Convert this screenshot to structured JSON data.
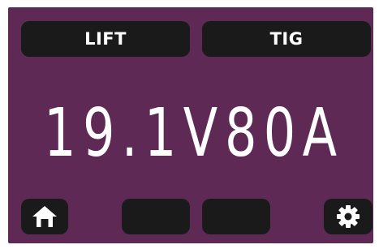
{
  "top_buttons": {
    "lift_label": "LIFT",
    "tig_label": "TIG"
  },
  "readout": {
    "voltage": "19.1V",
    "current": "80A"
  },
  "bottom_bar": {
    "home_icon": "home-icon",
    "settings_icon": "gear-icon"
  },
  "colors": {
    "screen_background": "#5e2a55",
    "button_background": "#1a1a1a",
    "text": "#ffffff"
  }
}
